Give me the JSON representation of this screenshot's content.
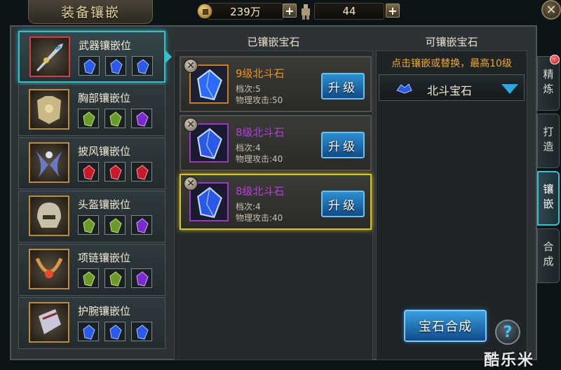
{
  "header": {
    "title": "装备镶嵌",
    "currency": "239万",
    "stat": "44",
    "plus": "+",
    "close": "✕"
  },
  "equipment": [
    {
      "name": "武器镶嵌位",
      "active": true,
      "slots": [
        "blue",
        "blue",
        "blue"
      ]
    },
    {
      "name": "胸部镶嵌位",
      "active": false,
      "slots": [
        "green",
        "green",
        "purple"
      ]
    },
    {
      "name": "披风镶嵌位",
      "active": false,
      "slots": [
        "red",
        "red",
        "red"
      ]
    },
    {
      "name": "头盔镶嵌位",
      "active": false,
      "slots": [
        "green",
        "green",
        "purple"
      ]
    },
    {
      "name": "项链镶嵌位",
      "active": false,
      "slots": [
        "green",
        "green",
        "purple"
      ]
    },
    {
      "name": "护腕镶嵌位",
      "active": false,
      "slots": [
        "blue",
        "blue",
        "blue"
      ]
    }
  ],
  "inlaid": {
    "header": "已镶嵌宝石",
    "upgrade_label": "升级",
    "remove_label": "✕",
    "gems": [
      {
        "name": "9级北斗石",
        "tier": "档次:5",
        "attr": "物理攻击:50",
        "rarity": "orange",
        "selected": false
      },
      {
        "name": "8级北斗石",
        "tier": "档次:4",
        "attr": "物理攻击:40",
        "rarity": "purple",
        "selected": false
      },
      {
        "name": "8级北斗石",
        "tier": "档次:4",
        "attr": "物理攻击:40",
        "rarity": "purple",
        "selected": true
      }
    ]
  },
  "available": {
    "header": "可镶嵌宝石",
    "hint": "点击镶嵌或替换，最高10级",
    "selected_gem": "北斗宝石"
  },
  "actions": {
    "synthesize": "宝石合成",
    "help": "?"
  },
  "side_tabs": [
    {
      "label": "精炼",
      "active": false
    },
    {
      "label": "打造",
      "active": false
    },
    {
      "label": "镶嵌",
      "active": true
    },
    {
      "label": "合成",
      "active": false
    }
  ],
  "watermark": "酷乐米",
  "colors": {
    "accent": "#33c0c8",
    "gem_orange_text": "#f0941e",
    "gem_purple_text": "#b640e0",
    "hint": "#f0a82a",
    "button_blue": "#2c8fd0"
  }
}
